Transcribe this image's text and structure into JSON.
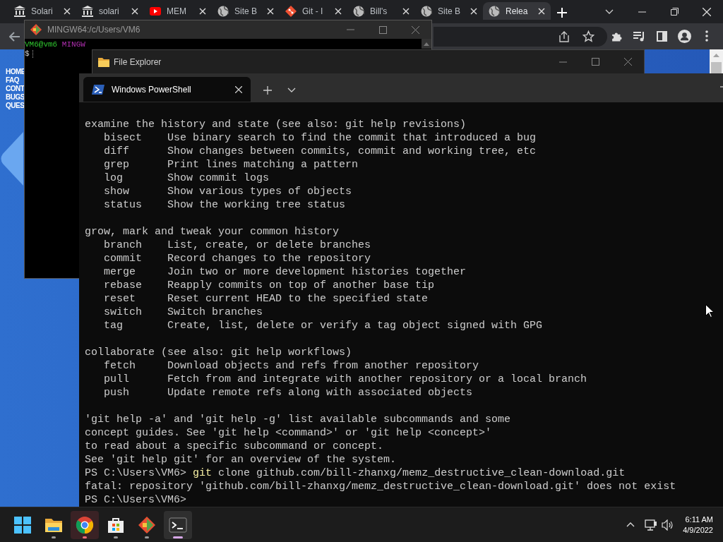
{
  "browser": {
    "tabs": [
      {
        "title": "Solari",
        "kind": "bank",
        "selected": false
      },
      {
        "title": "solari",
        "kind": "bank",
        "selected": false
      },
      {
        "title": "MEM",
        "kind": "video",
        "selected": false
      },
      {
        "title": "Site B",
        "kind": "globe",
        "selected": false
      },
      {
        "title": "Git - I",
        "kind": "git",
        "selected": false
      },
      {
        "title": "Bill's",
        "kind": "globe",
        "selected": false
      },
      {
        "title": "Site B",
        "kind": "globe",
        "selected": false
      },
      {
        "title": "Relea",
        "kind": "globe",
        "selected": true
      }
    ],
    "page_links": [
      "HOME",
      "FAQ",
      "CONT",
      "BUGS",
      "QUES"
    ]
  },
  "git_bash": {
    "title": "MINGW64:/c/Users/VM6",
    "prompt_user": "VM6@vm6",
    "prompt_shell": "MINGW",
    "prompt_symbol": "$"
  },
  "file_explorer": {
    "title": "File Explorer"
  },
  "powershell": {
    "tab_title": "Windows PowerShell",
    "lines": [
      {
        "kind": "text",
        "text": "examine the history and state (see also: git help revisions)"
      },
      {
        "kind": "text",
        "text": "   bisect    Use binary search to find the commit that introduced a bug"
      },
      {
        "kind": "text",
        "text": "   diff      Show changes between commits, commit and working tree, etc"
      },
      {
        "kind": "text",
        "text": "   grep      Print lines matching a pattern"
      },
      {
        "kind": "text",
        "text": "   log       Show commit logs"
      },
      {
        "kind": "text",
        "text": "   show      Show various types of objects"
      },
      {
        "kind": "text",
        "text": "   status    Show the working tree status"
      },
      {
        "kind": "blank"
      },
      {
        "kind": "text",
        "text": "grow, mark and tweak your common history"
      },
      {
        "kind": "text",
        "text": "   branch    List, create, or delete branches"
      },
      {
        "kind": "text",
        "text": "   commit    Record changes to the repository"
      },
      {
        "kind": "text",
        "text": "   merge     Join two or more development histories together"
      },
      {
        "kind": "text",
        "text": "   rebase    Reapply commits on top of another base tip"
      },
      {
        "kind": "text",
        "text": "   reset     Reset current HEAD to the specified state"
      },
      {
        "kind": "text",
        "text": "   switch    Switch branches"
      },
      {
        "kind": "text",
        "text": "   tag       Create, list, delete or verify a tag object signed with GPG"
      },
      {
        "kind": "blank"
      },
      {
        "kind": "text",
        "text": "collaborate (see also: git help workflows)"
      },
      {
        "kind": "text",
        "text": "   fetch     Download objects and refs from another repository"
      },
      {
        "kind": "text",
        "text": "   pull      Fetch from and integrate with another repository or a local branch"
      },
      {
        "kind": "text",
        "text": "   push      Update remote refs along with associated objects"
      },
      {
        "kind": "blank"
      },
      {
        "kind": "text",
        "text": "'git help -a' and 'git help -g' list available subcommands and some"
      },
      {
        "kind": "text",
        "text": "concept guides. See 'git help <command>' or 'git help <concept>'"
      },
      {
        "kind": "text",
        "text": "to read about a specific subcommand or concept."
      },
      {
        "kind": "text",
        "text": "See 'git help git' for an overview of the system."
      },
      {
        "kind": "command",
        "prompt": "PS C:\\Users\\VM6>",
        "command": "git",
        "args": "clone github.com/bill-zhanxg/memz_destructive_clean-download.git"
      },
      {
        "kind": "text",
        "text": "fatal: repository 'github.com/bill-zhanxg/memz_destructive_clean-download.git' does not exist"
      },
      {
        "kind": "prompt",
        "prompt": "PS C:\\Users\\VM6>"
      }
    ]
  },
  "taskbar": {
    "apps": [
      {
        "kind": "start",
        "open": false,
        "attention": false,
        "selected": false
      },
      {
        "kind": "explorer",
        "open": true,
        "attention": false,
        "selected": false
      },
      {
        "kind": "chrome",
        "open": true,
        "attention": true,
        "selected": false
      },
      {
        "kind": "store",
        "open": true,
        "attention": false,
        "selected": false
      },
      {
        "kind": "git",
        "open": true,
        "attention": false,
        "selected": false
      },
      {
        "kind": "terminal",
        "open": true,
        "attention": false,
        "selected": true
      }
    ],
    "time": "6:11 AM",
    "date": "4/9/2022"
  }
}
